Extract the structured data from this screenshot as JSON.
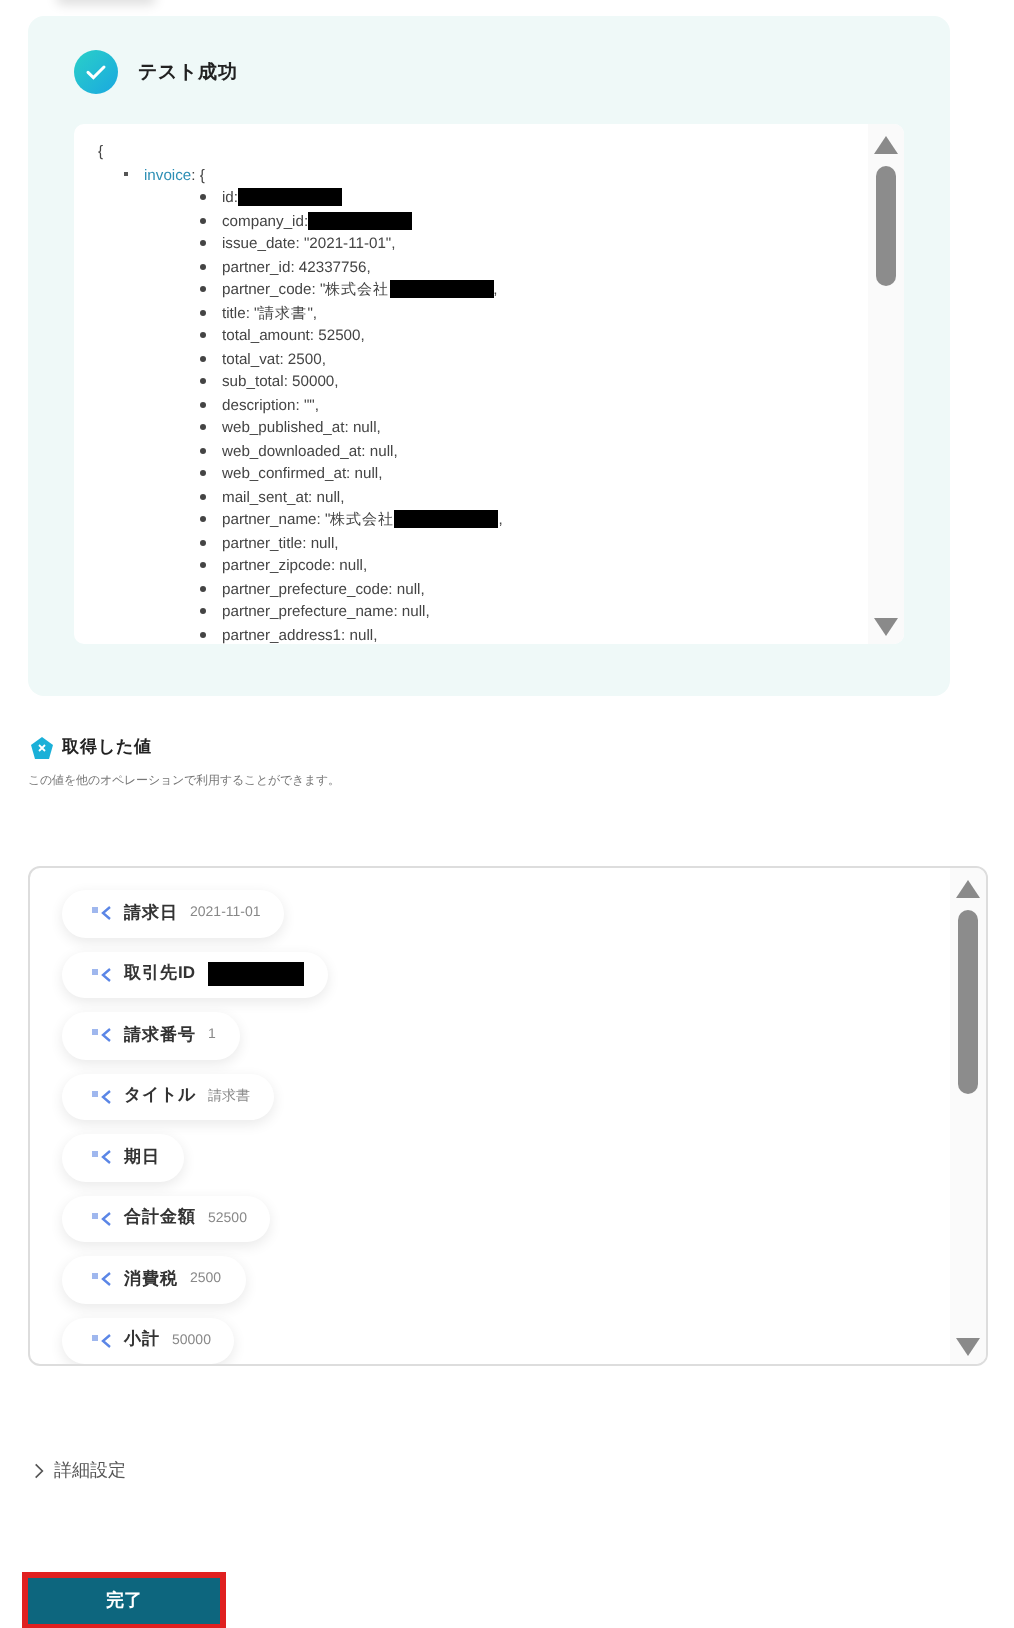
{
  "test_result": {
    "title": "テスト成功",
    "success": true,
    "json_open": "{",
    "object_key": "invoice",
    "object_open": ": {",
    "lines": [
      {
        "text": "id: ",
        "redacted": true
      },
      {
        "text": "company_id:",
        "redacted": true
      },
      {
        "text": "issue_date: \"2021-11-01\","
      },
      {
        "text": "partner_id: 42337756,"
      },
      {
        "text": "partner_code: \"株式会社",
        "redacted": true,
        "after": ","
      },
      {
        "text": "title: \"請求書\","
      },
      {
        "text": "total_amount: 52500,"
      },
      {
        "text": "total_vat: 2500,"
      },
      {
        "text": "sub_total: 50000,"
      },
      {
        "text": "description: \"\","
      },
      {
        "text": "web_published_at: null,"
      },
      {
        "text": "web_downloaded_at: null,"
      },
      {
        "text": "web_confirmed_at: null,"
      },
      {
        "text": "mail_sent_at: null,"
      },
      {
        "text": "partner_name: \"株式会社",
        "redacted": true,
        "after": ","
      },
      {
        "text": "partner_title: null,"
      },
      {
        "text": "partner_zipcode: null,"
      },
      {
        "text": "partner_prefecture_code: null,"
      },
      {
        "text": "partner_prefecture_name: null,"
      },
      {
        "text": "partner_address1: null,"
      }
    ]
  },
  "values": {
    "title": "取得した値",
    "subtitle": "この値を他のオペレーションで利用することができます。",
    "items": [
      {
        "label": "請求日",
        "value": "2021-11-01"
      },
      {
        "label": "取引先ID",
        "redacted": true
      },
      {
        "label": "請求番号",
        "value": "1"
      },
      {
        "label": "タイトル",
        "value": "請求書"
      },
      {
        "label": "期日"
      },
      {
        "label": "合計金額",
        "value": "52500"
      },
      {
        "label": "消費税",
        "value": "2500"
      },
      {
        "label": "小計",
        "value": "50000"
      }
    ]
  },
  "advanced": {
    "label": "詳細設定",
    "expanded": false
  },
  "done_button": {
    "label": "完了",
    "highlighted": true
  }
}
